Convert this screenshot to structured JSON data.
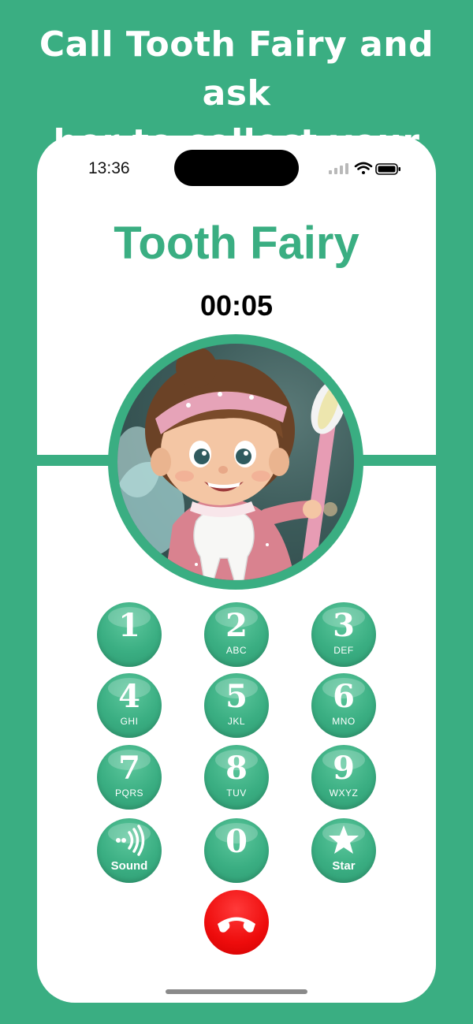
{
  "promo": {
    "line1": "Call Tooth Fairy and ask",
    "line2": "her to collect your tooth!"
  },
  "status_bar": {
    "time": "13:36",
    "icons": [
      "signal-icon",
      "wifi-icon",
      "battery-icon"
    ]
  },
  "call": {
    "caller_name": "Tooth Fairy",
    "duration": "00:05",
    "avatar": "tooth-fairy-portrait"
  },
  "keypad": {
    "keys": [
      {
        "digit": "1",
        "letters": ""
      },
      {
        "digit": "2",
        "letters": "ABC"
      },
      {
        "digit": "3",
        "letters": "DEF"
      },
      {
        "digit": "4",
        "letters": "GHI"
      },
      {
        "digit": "5",
        "letters": "JKL"
      },
      {
        "digit": "6",
        "letters": "MNO"
      },
      {
        "digit": "7",
        "letters": "PQRS"
      },
      {
        "digit": "8",
        "letters": "TUV"
      },
      {
        "digit": "9",
        "letters": "WXYZ"
      }
    ],
    "sound": {
      "label": "Sound",
      "icon": "sound-icon"
    },
    "zero": {
      "digit": "0"
    },
    "star": {
      "label": "Star",
      "icon": "star-icon"
    }
  },
  "end_call": {
    "icon": "hang-up-icon"
  },
  "colors": {
    "accent": "#3aae82",
    "end_call": "#ee0c0c",
    "screen": "#ffffff"
  }
}
